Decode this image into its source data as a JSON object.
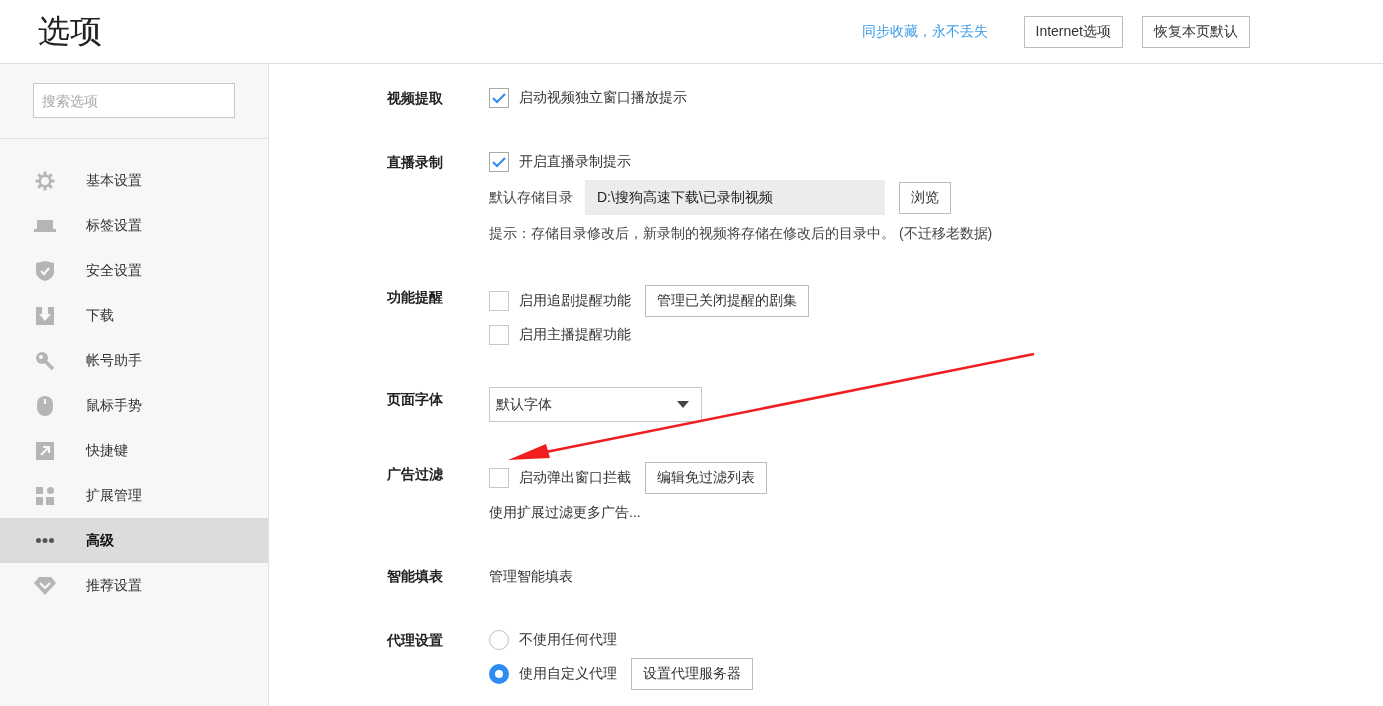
{
  "window": {
    "title": "选项"
  },
  "header": {
    "sync_link": "同步收藏，永不丢失",
    "buttons": [
      "Internet选项",
      "恢复本页默认"
    ]
  },
  "sidebar": {
    "search": {
      "placeholder": "搜索选项"
    },
    "items": [
      {
        "label": "基本设置",
        "selected": false
      },
      {
        "label": "标签设置",
        "selected": false
      },
      {
        "label": "安全设置",
        "selected": false
      },
      {
        "label": "下载",
        "selected": false
      },
      {
        "label": "帐号助手",
        "selected": false
      },
      {
        "label": "鼠标手势",
        "selected": false
      },
      {
        "label": "快捷键",
        "selected": false
      },
      {
        "label": "扩展管理",
        "selected": false
      },
      {
        "label": "高级",
        "selected": true
      },
      {
        "label": "推荐设置",
        "selected": false
      }
    ]
  },
  "sections": [
    {
      "label": "视频提取",
      "rows": [
        {
          "kind": "checkbox",
          "label": "启动视频独立窗口播放提示",
          "checked": true
        }
      ]
    },
    {
      "label": "直播录制",
      "rows": [
        {
          "kind": "checkbox",
          "label": "开启直播录制提示",
          "checked": true
        },
        {
          "kind": "path",
          "label": "默认存储目录",
          "value": "D:\\搜狗高速下载\\已录制视频",
          "button": "浏览"
        },
        {
          "kind": "hint",
          "text": "提示：存储目录修改后，新录制的视频将存储在修改后的目录中。 (不迁移老数据)"
        }
      ]
    },
    {
      "label": "功能提醒",
      "rows": [
        {
          "kind": "checkbox",
          "label": "启用追剧提醒功能",
          "checked": false,
          "button": "管理已关闭提醒的剧集"
        },
        {
          "kind": "checkbox",
          "label": "启用主播提醒功能",
          "checked": false
        }
      ]
    },
    {
      "label": "页面字体",
      "rows": [
        {
          "kind": "select",
          "value": "默认字体"
        }
      ]
    },
    {
      "label": "广告过滤",
      "rows": [
        {
          "kind": "checkbox",
          "label": "启动弹出窗口拦截",
          "checked": false,
          "button": "编辑免过滤列表"
        },
        {
          "kind": "link",
          "text": "使用扩展过滤更多广告..."
        }
      ]
    },
    {
      "label": "智能填表",
      "rows": [
        {
          "kind": "link",
          "text": "管理智能填表"
        }
      ]
    },
    {
      "label": "代理设置",
      "rows": [
        {
          "kind": "radio",
          "label": "不使用任何代理",
          "selected": false
        },
        {
          "kind": "radio",
          "label": "使用自定义代理",
          "selected": true,
          "button": "设置代理服务器"
        }
      ]
    }
  ]
}
